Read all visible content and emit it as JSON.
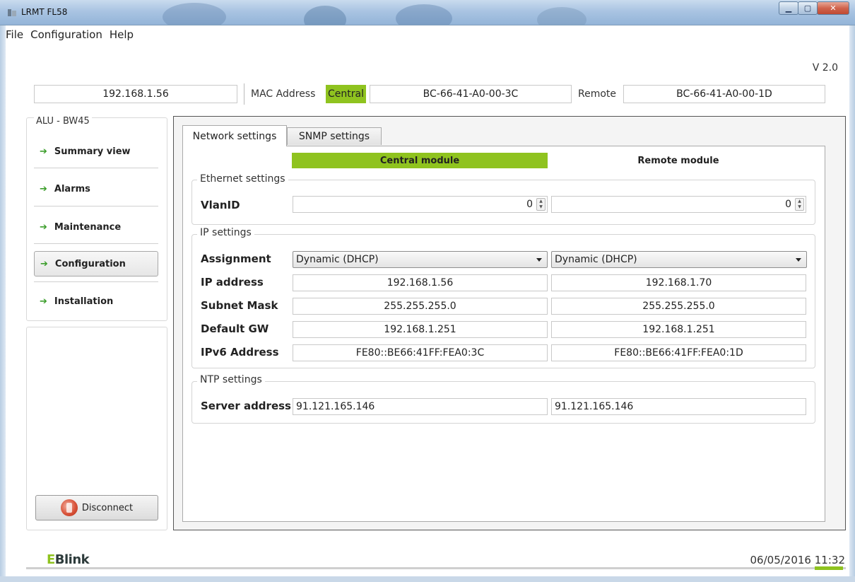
{
  "window": {
    "title": "LRMT FL58"
  },
  "menu": {
    "items": [
      "File",
      "Configuration",
      "Help"
    ]
  },
  "header": {
    "version": "V 2.0",
    "ip": "192.168.1.56",
    "mac_label": "MAC Address",
    "central_label": "Central",
    "central_mac": "BC-66-41-A0-00-3C",
    "remote_label": "Remote",
    "remote_mac": "BC-66-41-A0-00-1D"
  },
  "sidebar": {
    "title": "ALU - BW45",
    "items": [
      {
        "label": "Summary view",
        "active": false
      },
      {
        "label": "Alarms",
        "active": false
      },
      {
        "label": "Maintenance",
        "active": false
      },
      {
        "label": "Configuration",
        "active": true
      },
      {
        "label": "Installation",
        "active": false
      }
    ],
    "disconnect_label": "Disconnect"
  },
  "tabs": [
    {
      "label": "Network settings",
      "active": true
    },
    {
      "label": "SNMP settings",
      "active": false
    }
  ],
  "columns": {
    "central": "Central module",
    "remote": "Remote module"
  },
  "ethernet": {
    "legend": "Ethernet settings",
    "vlan_label": "VlanID",
    "vlan_central": "0",
    "vlan_remote": "0"
  },
  "ip_settings": {
    "legend": "IP settings",
    "assignment_label": "Assignment",
    "assignment_central": "Dynamic (DHCP)",
    "assignment_remote": "Dynamic (DHCP)",
    "ip_label": "IP address",
    "ip_central": "192.168.1.56",
    "ip_remote": "192.168.1.70",
    "mask_label": "Subnet Mask",
    "mask_central": "255.255.255.0",
    "mask_remote": "255.255.255.0",
    "gw_label": "Default GW",
    "gw_central": "192.168.1.251",
    "gw_remote": "192.168.1.251",
    "ipv6_label": "IPv6 Address",
    "ipv6_central": "FE80::BE66:41FF:FEA0:3C",
    "ipv6_remote": "FE80::BE66:41FF:FEA0:1D"
  },
  "ntp": {
    "legend": "NTP settings",
    "server_label": "Server address",
    "server_central": "91.121.165.146",
    "server_remote": "91.121.165.146"
  },
  "footer": {
    "logo_e": "E",
    "logo_rest": "Blink",
    "date": "06/05/2016",
    "time": "11:32"
  },
  "colors": {
    "accent": "#8fc31f",
    "arrow": "#3b9d2a"
  }
}
